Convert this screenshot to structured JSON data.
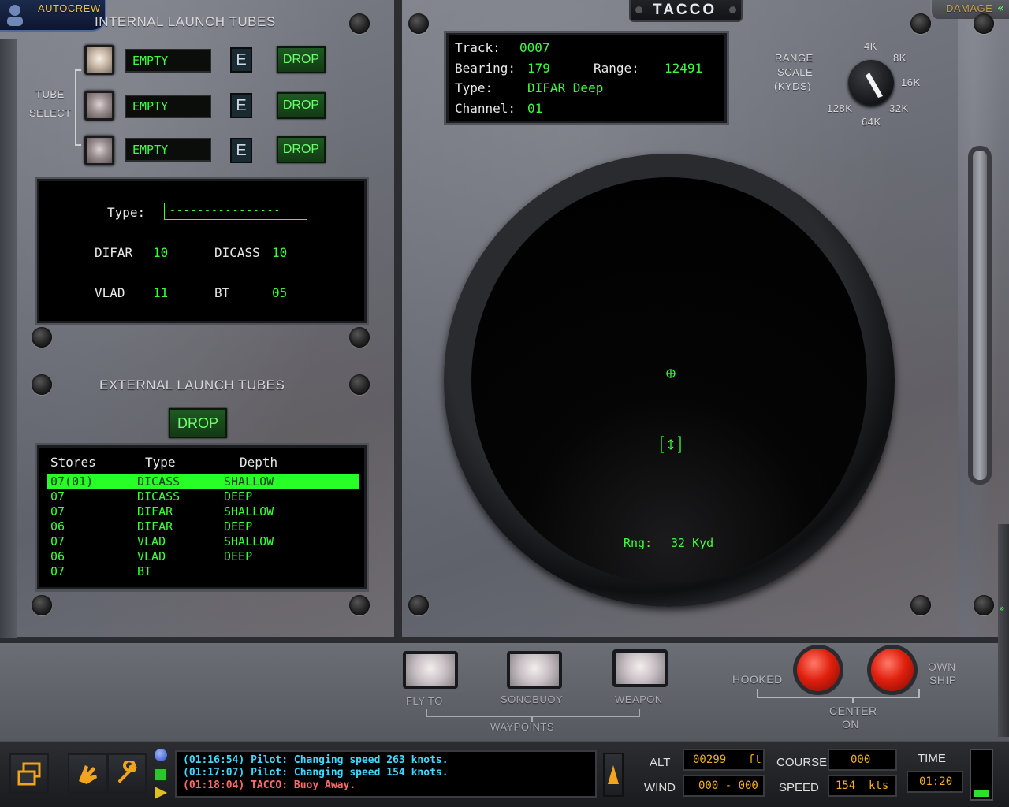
{
  "top_bar": {
    "autocrew_label": "AUTOCREW",
    "damage_label": "DAMAGE",
    "station_title": "TACCO"
  },
  "internal_tubes": {
    "title": "INTERNAL LAUNCH TUBES",
    "tube_select_label_1": "TUBE",
    "tube_select_label_2": "SELECT",
    "tubes": [
      {
        "status": "EMPTY",
        "e_label": "E",
        "drop_label": "DROP"
      },
      {
        "status": "EMPTY",
        "e_label": "E",
        "drop_label": "DROP"
      },
      {
        "status": "EMPTY",
        "e_label": "E",
        "drop_label": "DROP"
      }
    ]
  },
  "inventory": {
    "type_label": "Type:",
    "type_value": "----------------",
    "difar_label": "DIFAR",
    "difar_value": "10",
    "dicass_label": "DICASS",
    "dicass_value": "10",
    "vlad_label": "VLAD",
    "vlad_value": "11",
    "bt_label": "BT",
    "bt_value": "05"
  },
  "external_tubes": {
    "title": "EXTERNAL LAUNCH TUBES",
    "drop_label": "DROP",
    "columns": {
      "stores": "Stores",
      "type": "Type",
      "depth": "Depth"
    },
    "rows": [
      {
        "stores": "07(01)",
        "type": "DICASS",
        "depth": "SHALLOW",
        "selected": true
      },
      {
        "stores": "07",
        "type": "DICASS",
        "depth": "DEEP"
      },
      {
        "stores": "07",
        "type": "DIFAR",
        "depth": "SHALLOW"
      },
      {
        "stores": "06",
        "type": "DIFAR",
        "depth": "DEEP"
      },
      {
        "stores": "07",
        "type": "VLAD",
        "depth": "SHALLOW"
      },
      {
        "stores": "06",
        "type": "VLAD",
        "depth": "DEEP"
      },
      {
        "stores": "07",
        "type": "BT",
        "depth": ""
      }
    ]
  },
  "track_info": {
    "track_label": "Track:",
    "track_value": "0007",
    "bearing_label": "Bearing:",
    "bearing_value": "179",
    "range_label": "Range:",
    "range_value": "12491",
    "type_label": "Type:",
    "type_value": "DIFAR Deep",
    "channel_label": "Channel:",
    "channel_value": "01"
  },
  "range_scale": {
    "label_1": "RANGE",
    "label_2": "SCALE",
    "label_3": "(KYDS)",
    "options": [
      "4K",
      "8K",
      "16K",
      "32K",
      "64K",
      "128K"
    ],
    "selected": "32K"
  },
  "scope": {
    "range_label": "Rng:",
    "range_value": "32 Kyd"
  },
  "waypoint_buttons": {
    "fly_to": "FLY TO",
    "sonobuoy": "SONOBUOY",
    "weapon": "WEAPON",
    "group_label": "WAYPOINTS"
  },
  "center_controls": {
    "hooked": "HOOKED",
    "own_1": "OWN",
    "own_2": "SHIP",
    "center_1": "CENTER",
    "center_2": "ON"
  },
  "status_bar": {
    "messages": [
      {
        "text": "(01:16:54) Pilot: Changing speed 263 knots.",
        "color": "#3fd9ff"
      },
      {
        "text": "(01:17:07) Pilot: Changing speed 154 knots.",
        "color": "#3fd9ff"
      },
      {
        "text": "(01:18:04) TACCO: Buoy Away.",
        "color": "#ff6a6a"
      }
    ],
    "alt_label": "ALT",
    "alt_value": "00299",
    "alt_unit": "ft",
    "wind_label": "WIND",
    "wind_value": "000 - 000",
    "course_label": "COURSE",
    "course_value": "000",
    "speed_label": "SPEED",
    "speed_value": "154",
    "speed_unit": "kts",
    "time_label": "TIME",
    "time_value": "01:20",
    "fuel_level": 0.15
  },
  "colors": {
    "crt_green": "#3cff3c",
    "selected_row": "#27ff27",
    "amber": "#f2b01c"
  }
}
